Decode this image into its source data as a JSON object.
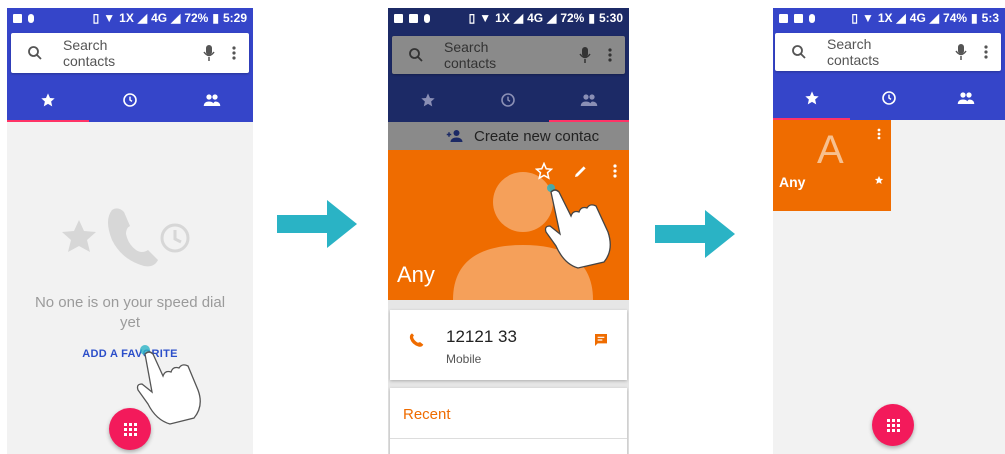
{
  "colors": {
    "status_bar": "#3545c9",
    "tab_bar": "#3545c9",
    "tab_indicator": "#ff3366",
    "contact_header": "#ef6c00",
    "fab": "#f31a5b",
    "accent_orange": "#ef6c00",
    "link_blue": "#2b4ec9",
    "arrow": "#2ab3c5"
  },
  "phone1": {
    "status": {
      "network": "1X",
      "data": "4G",
      "battery": "72%",
      "time": "5:29"
    },
    "search": {
      "placeholder": "Search contacts"
    },
    "tabs": [
      {
        "icon": "star-icon",
        "active": true
      },
      {
        "icon": "clock-icon",
        "active": false
      },
      {
        "icon": "people-icon",
        "active": false
      }
    ],
    "empty_state": {
      "line1": "No one is on your speed dial",
      "line2": "yet"
    },
    "add_favorite_label": "ADD A FAVORITE"
  },
  "phone2": {
    "status": {
      "network": "1X",
      "data": "4G",
      "battery": "72%",
      "time": "5:30"
    },
    "search": {
      "placeholder": "Search contacts"
    },
    "create_contact": "Create new contac",
    "contact": {
      "name": "Any",
      "phone": "12121 33",
      "phone_type": "Mobile"
    },
    "recent_label": "Recent"
  },
  "phone3": {
    "status": {
      "network": "1X",
      "data": "4G",
      "battery": "74%",
      "time": "5:3"
    },
    "search": {
      "placeholder": "Search contacts"
    },
    "favorite": {
      "initial": "A",
      "name": "Any"
    }
  }
}
